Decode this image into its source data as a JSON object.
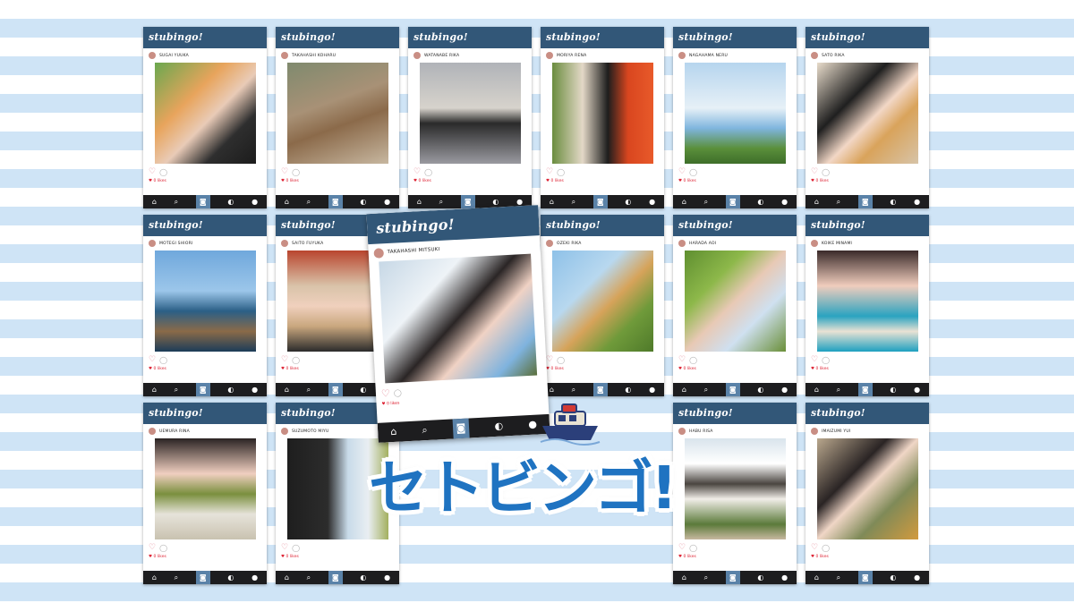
{
  "brand_header": "stubingo!",
  "nav_icons": [
    "home-icon",
    "search-icon",
    "camera-icon",
    "chat-icon",
    "profile-icon"
  ],
  "logo_title": "セトビンゴ!",
  "colors": {
    "header": "#325778",
    "navbar": "#1d1d1f",
    "logo": "#1f73c1",
    "stripe": "#cfe4f6"
  },
  "cards": [
    {
      "name": "SUGAI YUUKA",
      "likes": "♥ 0 likes"
    },
    {
      "name": "TAKAHASHI KOHARU",
      "likes": "♥ 0 likes"
    },
    {
      "name": "WATANABE RIKA",
      "likes": "♥ 0 likes"
    },
    {
      "name": "MORIYA RENA",
      "likes": "♥ 0 likes"
    },
    {
      "name": "NAGAHAMA NERU",
      "likes": "♥ 0 likes"
    },
    {
      "name": "SATO RIKA",
      "likes": "♥ 0 likes"
    },
    {
      "name": "MOTEGI SHIORI",
      "likes": "♥ 0 likes"
    },
    {
      "name": "SAITO FUYUKA",
      "likes": "♥ 0 likes"
    },
    {
      "name": "OZEKI RIKA",
      "likes": "♥ 0 likes"
    },
    {
      "name": "HARADA AOI",
      "likes": "♥ 0 likes"
    },
    {
      "name": "KOIKE MINAMI",
      "likes": "♥ 0 likes"
    },
    {
      "name": "UEMURA RINA",
      "likes": "♥ 0 likes"
    },
    {
      "name": "SUZUMOTO MIYU",
      "likes": "♥ 0 likes"
    },
    {
      "name": "HABU RISA",
      "likes": "♥ 0 likes"
    },
    {
      "name": "IMAIZUMI YUI",
      "likes": "♥ 0 likes"
    }
  ],
  "big_card": {
    "name": "TAKAHASHI MITSUKI",
    "likes": "♥ 0 likes"
  }
}
